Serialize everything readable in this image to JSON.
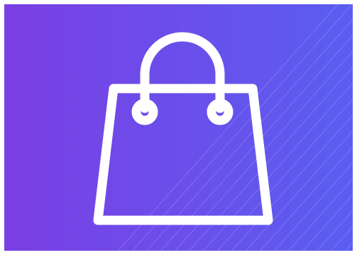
{
  "graphic": {
    "icon": "shopping-bag-icon",
    "gradient_start": "#7b3fe4",
    "gradient_end": "#5a5ef0",
    "icon_color": "#ffffff",
    "stripe_color": "#ffffff"
  }
}
